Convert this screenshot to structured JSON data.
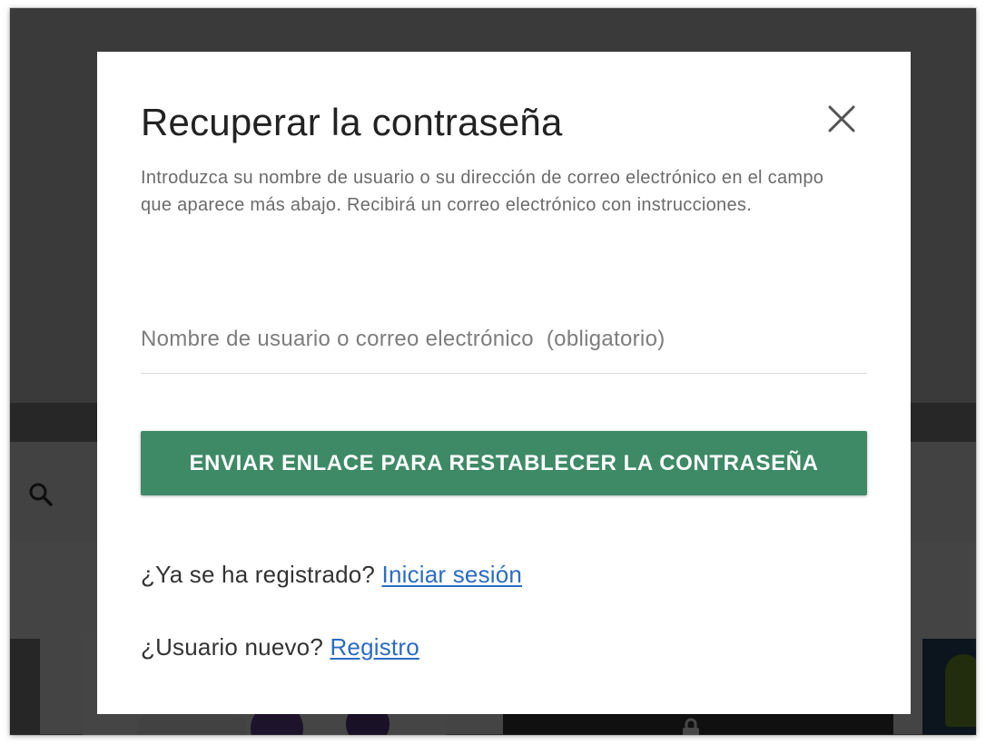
{
  "dialog": {
    "title": "Recuperar la contraseña",
    "description": "Introduzca su nombre de usuario o su dirección de correo electrónico en el campo que aparece más abajo. Recibirá un correo electrónico con instrucciones.",
    "close_icon": "close-icon",
    "username_field": {
      "placeholder": "Nombre de usuario o correo electrónico  (obligatorio)",
      "value": ""
    },
    "submit_label": "ENVIAR ENLACE PARA RESTABLECER LA CONTRASEÑA",
    "login_prompt": "¿Ya se ha registrado?",
    "login_link": "Iniciar sesión",
    "register_prompt": "¿Usuario nuevo?",
    "register_link": "Registro"
  },
  "background": {
    "search_icon": "search-icon"
  },
  "colors": {
    "button": "#3e8a66",
    "link": "#2b6cc4",
    "overlay": "rgba(0,0,0,0.72)"
  }
}
